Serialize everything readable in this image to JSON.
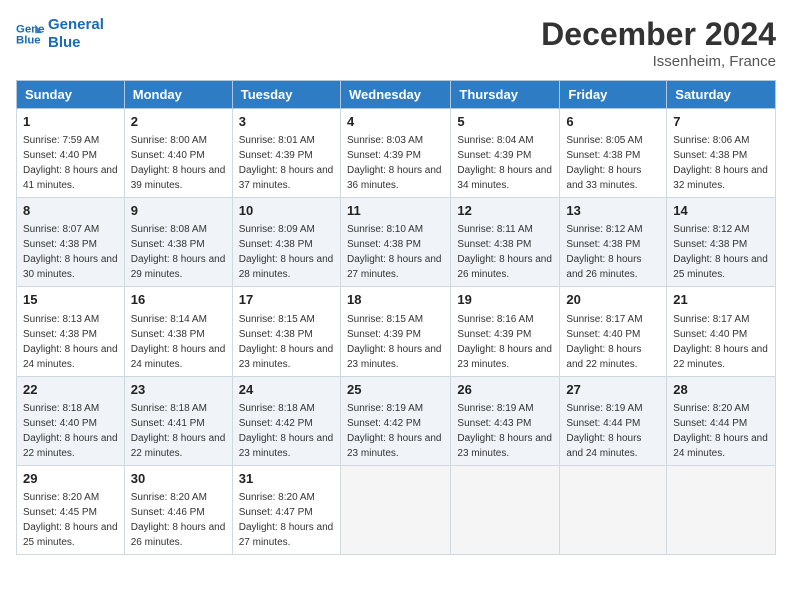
{
  "header": {
    "logo_line1": "General",
    "logo_line2": "Blue",
    "month": "December 2024",
    "location": "Issenheim, France"
  },
  "days_of_week": [
    "Sunday",
    "Monday",
    "Tuesday",
    "Wednesday",
    "Thursday",
    "Friday",
    "Saturday"
  ],
  "weeks": [
    [
      {
        "day": "1",
        "sunrise": "Sunrise: 7:59 AM",
        "sunset": "Sunset: 4:40 PM",
        "daylight": "Daylight: 8 hours and 41 minutes."
      },
      {
        "day": "2",
        "sunrise": "Sunrise: 8:00 AM",
        "sunset": "Sunset: 4:40 PM",
        "daylight": "Daylight: 8 hours and 39 minutes."
      },
      {
        "day": "3",
        "sunrise": "Sunrise: 8:01 AM",
        "sunset": "Sunset: 4:39 PM",
        "daylight": "Daylight: 8 hours and 37 minutes."
      },
      {
        "day": "4",
        "sunrise": "Sunrise: 8:03 AM",
        "sunset": "Sunset: 4:39 PM",
        "daylight": "Daylight: 8 hours and 36 minutes."
      },
      {
        "day": "5",
        "sunrise": "Sunrise: 8:04 AM",
        "sunset": "Sunset: 4:39 PM",
        "daylight": "Daylight: 8 hours and 34 minutes."
      },
      {
        "day": "6",
        "sunrise": "Sunrise: 8:05 AM",
        "sunset": "Sunset: 4:38 PM",
        "daylight": "Daylight: 8 hours and 33 minutes."
      },
      {
        "day": "7",
        "sunrise": "Sunrise: 8:06 AM",
        "sunset": "Sunset: 4:38 PM",
        "daylight": "Daylight: 8 hours and 32 minutes."
      }
    ],
    [
      {
        "day": "8",
        "sunrise": "Sunrise: 8:07 AM",
        "sunset": "Sunset: 4:38 PM",
        "daylight": "Daylight: 8 hours and 30 minutes."
      },
      {
        "day": "9",
        "sunrise": "Sunrise: 8:08 AM",
        "sunset": "Sunset: 4:38 PM",
        "daylight": "Daylight: 8 hours and 29 minutes."
      },
      {
        "day": "10",
        "sunrise": "Sunrise: 8:09 AM",
        "sunset": "Sunset: 4:38 PM",
        "daylight": "Daylight: 8 hours and 28 minutes."
      },
      {
        "day": "11",
        "sunrise": "Sunrise: 8:10 AM",
        "sunset": "Sunset: 4:38 PM",
        "daylight": "Daylight: 8 hours and 27 minutes."
      },
      {
        "day": "12",
        "sunrise": "Sunrise: 8:11 AM",
        "sunset": "Sunset: 4:38 PM",
        "daylight": "Daylight: 8 hours and 26 minutes."
      },
      {
        "day": "13",
        "sunrise": "Sunrise: 8:12 AM",
        "sunset": "Sunset: 4:38 PM",
        "daylight": "Daylight: 8 hours and 26 minutes."
      },
      {
        "day": "14",
        "sunrise": "Sunrise: 8:12 AM",
        "sunset": "Sunset: 4:38 PM",
        "daylight": "Daylight: 8 hours and 25 minutes."
      }
    ],
    [
      {
        "day": "15",
        "sunrise": "Sunrise: 8:13 AM",
        "sunset": "Sunset: 4:38 PM",
        "daylight": "Daylight: 8 hours and 24 minutes."
      },
      {
        "day": "16",
        "sunrise": "Sunrise: 8:14 AM",
        "sunset": "Sunset: 4:38 PM",
        "daylight": "Daylight: 8 hours and 24 minutes."
      },
      {
        "day": "17",
        "sunrise": "Sunrise: 8:15 AM",
        "sunset": "Sunset: 4:38 PM",
        "daylight": "Daylight: 8 hours and 23 minutes."
      },
      {
        "day": "18",
        "sunrise": "Sunrise: 8:15 AM",
        "sunset": "Sunset: 4:39 PM",
        "daylight": "Daylight: 8 hours and 23 minutes."
      },
      {
        "day": "19",
        "sunrise": "Sunrise: 8:16 AM",
        "sunset": "Sunset: 4:39 PM",
        "daylight": "Daylight: 8 hours and 23 minutes."
      },
      {
        "day": "20",
        "sunrise": "Sunrise: 8:17 AM",
        "sunset": "Sunset: 4:40 PM",
        "daylight": "Daylight: 8 hours and 22 minutes."
      },
      {
        "day": "21",
        "sunrise": "Sunrise: 8:17 AM",
        "sunset": "Sunset: 4:40 PM",
        "daylight": "Daylight: 8 hours and 22 minutes."
      }
    ],
    [
      {
        "day": "22",
        "sunrise": "Sunrise: 8:18 AM",
        "sunset": "Sunset: 4:40 PM",
        "daylight": "Daylight: 8 hours and 22 minutes."
      },
      {
        "day": "23",
        "sunrise": "Sunrise: 8:18 AM",
        "sunset": "Sunset: 4:41 PM",
        "daylight": "Daylight: 8 hours and 22 minutes."
      },
      {
        "day": "24",
        "sunrise": "Sunrise: 8:18 AM",
        "sunset": "Sunset: 4:42 PM",
        "daylight": "Daylight: 8 hours and 23 minutes."
      },
      {
        "day": "25",
        "sunrise": "Sunrise: 8:19 AM",
        "sunset": "Sunset: 4:42 PM",
        "daylight": "Daylight: 8 hours and 23 minutes."
      },
      {
        "day": "26",
        "sunrise": "Sunrise: 8:19 AM",
        "sunset": "Sunset: 4:43 PM",
        "daylight": "Daylight: 8 hours and 23 minutes."
      },
      {
        "day": "27",
        "sunrise": "Sunrise: 8:19 AM",
        "sunset": "Sunset: 4:44 PM",
        "daylight": "Daylight: 8 hours and 24 minutes."
      },
      {
        "day": "28",
        "sunrise": "Sunrise: 8:20 AM",
        "sunset": "Sunset: 4:44 PM",
        "daylight": "Daylight: 8 hours and 24 minutes."
      }
    ],
    [
      {
        "day": "29",
        "sunrise": "Sunrise: 8:20 AM",
        "sunset": "Sunset: 4:45 PM",
        "daylight": "Daylight: 8 hours and 25 minutes."
      },
      {
        "day": "30",
        "sunrise": "Sunrise: 8:20 AM",
        "sunset": "Sunset: 4:46 PM",
        "daylight": "Daylight: 8 hours and 26 minutes."
      },
      {
        "day": "31",
        "sunrise": "Sunrise: 8:20 AM",
        "sunset": "Sunset: 4:47 PM",
        "daylight": "Daylight: 8 hours and 27 minutes."
      },
      null,
      null,
      null,
      null
    ]
  ]
}
